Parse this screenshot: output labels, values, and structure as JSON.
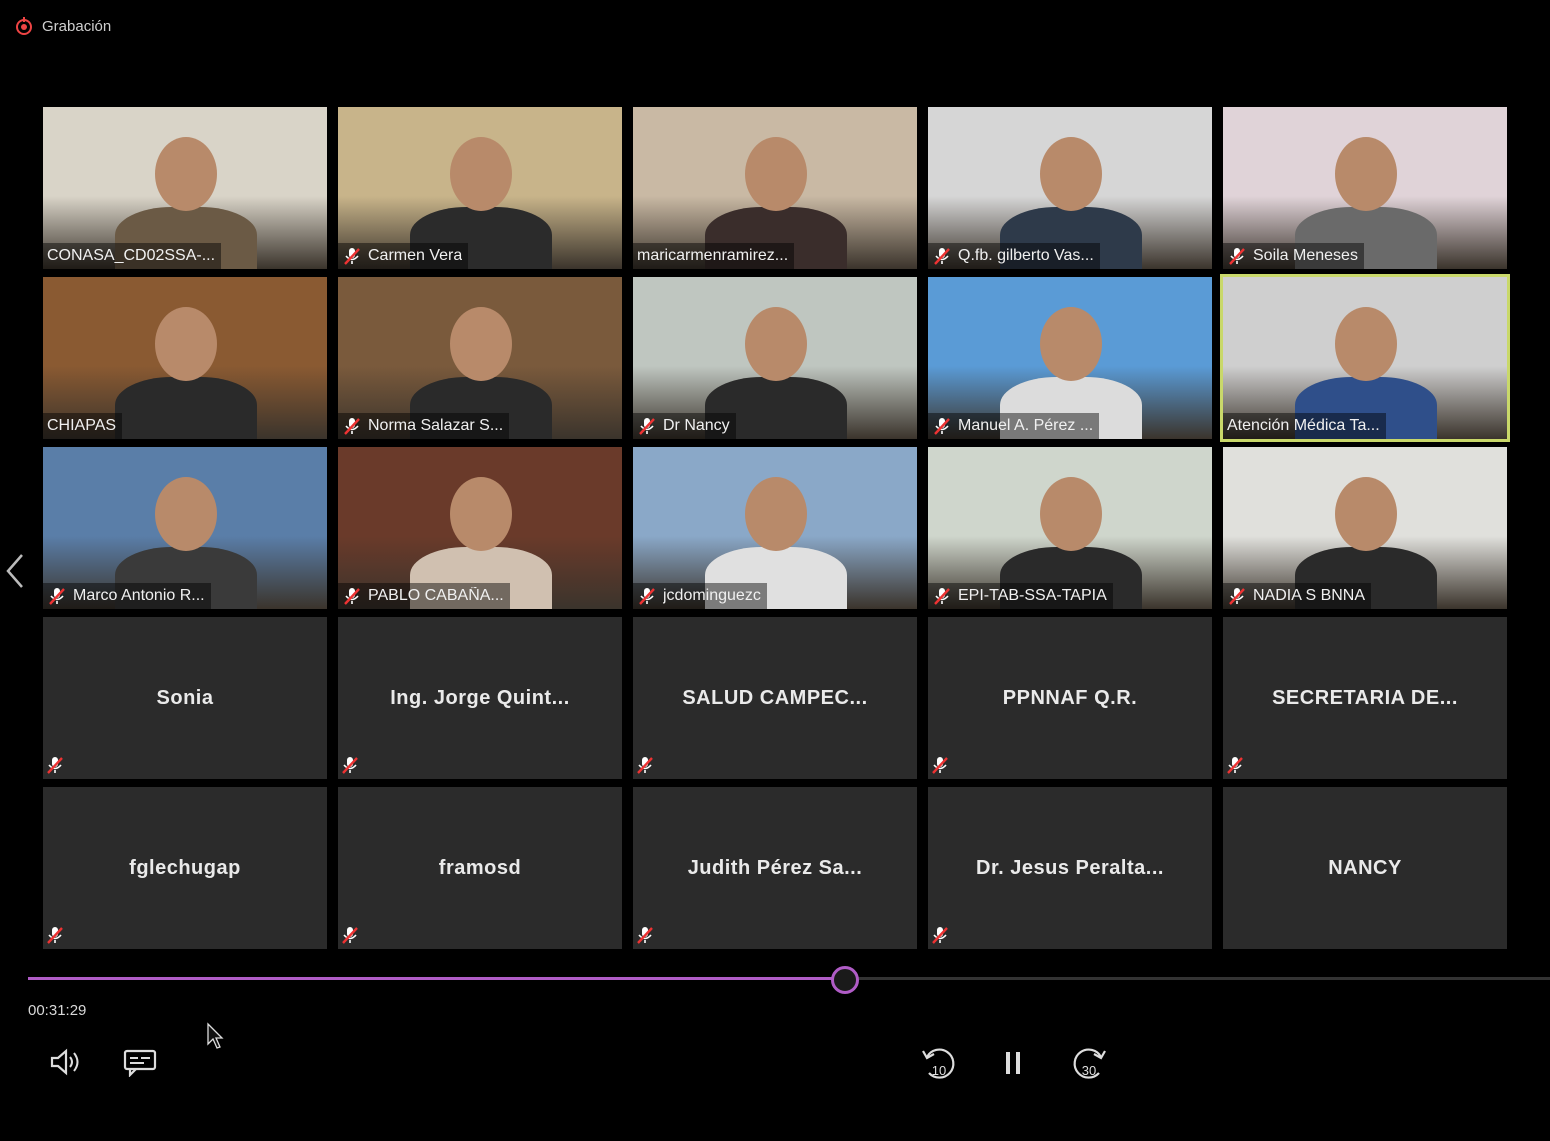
{
  "recording": {
    "label": "Grabación"
  },
  "tiles": [
    {
      "name": "CONASA_CD02SSA-...",
      "video": true,
      "muted": false,
      "scene": "office"
    },
    {
      "name": "Carmen Vera",
      "video": true,
      "muted": true,
      "scene": "woman"
    },
    {
      "name": "maricarmenramirez...",
      "video": true,
      "muted": false,
      "scene": "woman2"
    },
    {
      "name": "Q.fb. gilberto Vas...",
      "video": true,
      "muted": true,
      "scene": "two"
    },
    {
      "name": "Soila Meneses",
      "video": true,
      "muted": true,
      "scene": "woman3"
    },
    {
      "name": "CHIAPAS",
      "video": true,
      "muted": false,
      "scene": "meeting"
    },
    {
      "name": "Norma Salazar S...",
      "video": true,
      "muted": true,
      "scene": "shelf"
    },
    {
      "name": "Dr Nancy",
      "video": true,
      "muted": true,
      "scene": "window"
    },
    {
      "name": "Manuel A. Pérez ...",
      "video": true,
      "muted": true,
      "scene": "man"
    },
    {
      "name": "Atención Médica Ta...",
      "video": true,
      "muted": false,
      "active": true,
      "scene": "man2"
    },
    {
      "name": "Marco Antonio R...",
      "video": true,
      "muted": true,
      "scene": "man3"
    },
    {
      "name": "PABLO CABAÑA...",
      "video": true,
      "muted": true,
      "scene": "books"
    },
    {
      "name": "jcdominguezc",
      "video": true,
      "muted": true,
      "scene": "man4"
    },
    {
      "name": "EPI-TAB-SSA-TAPIA",
      "video": true,
      "muted": true,
      "scene": "two2"
    },
    {
      "name": "NADIA S BNNA",
      "video": true,
      "muted": true,
      "scene": "woman4"
    },
    {
      "name": "Sonia",
      "video": false,
      "muted": true
    },
    {
      "name": "Ing. Jorge Quint...",
      "video": false,
      "muted": true
    },
    {
      "name": "SALUD CAMPEC...",
      "video": false,
      "muted": true
    },
    {
      "name": "PPNNAF Q.R.",
      "video": false,
      "muted": true
    },
    {
      "name": "SECRETARIA DE...",
      "video": false,
      "muted": true
    },
    {
      "name": "fglechugap",
      "video": false,
      "muted": true
    },
    {
      "name": "framosd",
      "video": false,
      "muted": true
    },
    {
      "name": "Judith Pérez Sa...",
      "video": false,
      "muted": true
    },
    {
      "name": "Dr. Jesus Peralta...",
      "video": false,
      "muted": true
    },
    {
      "name": "NANCY",
      "video": false,
      "muted": false
    }
  ],
  "player": {
    "time": "00:31:29",
    "progress": 0.537,
    "rewind_label": "10",
    "forward_label": "30"
  },
  "colors": {
    "accent": "#b05cc6",
    "active_border": "#c9d86a",
    "tile_bg": "#2b2b2b"
  },
  "icons": [
    "recording-icon",
    "mic-muted-icon",
    "volume-icon",
    "captions-icon",
    "rewind-10-icon",
    "pause-icon",
    "forward-30-icon",
    "chevron-left-icon"
  ]
}
